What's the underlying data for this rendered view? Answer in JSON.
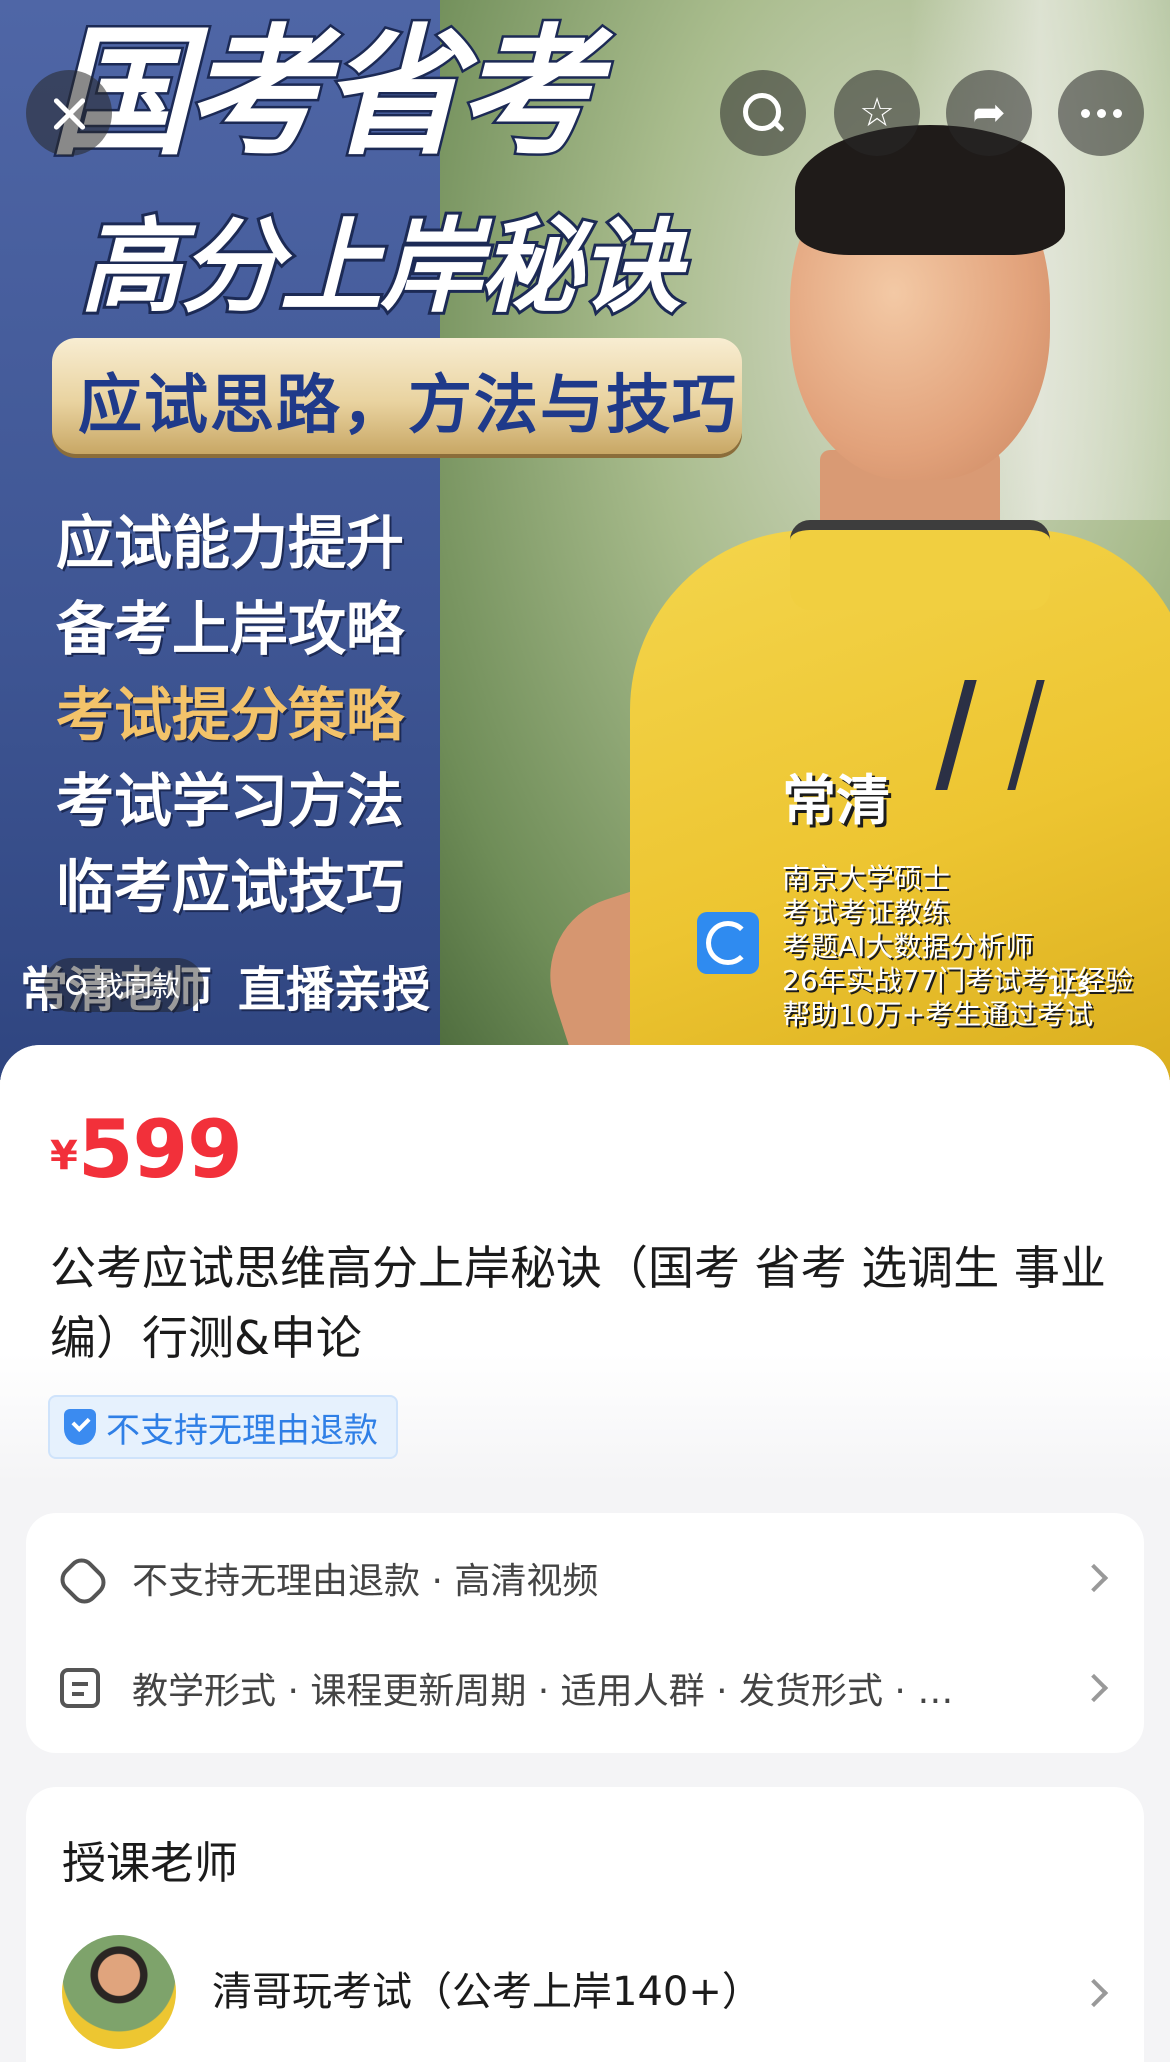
{
  "hero": {
    "headline_line1": "国考省考",
    "headline_line2": "高分上岸秘诀",
    "banner_text": "应试思路，方法与技巧",
    "bullet_lines": [
      "应试能力提升",
      "备考上岸攻略",
      "考试提分策略",
      "考试学习方法",
      "临考应试技巧"
    ],
    "bottom_left": "常清老师",
    "bottom_mid": "直播亲授",
    "teacher_name": "常清",
    "teacher_bio": [
      "南京大学硕士",
      "考试考证教练",
      "考题AI大数据分析师",
      "26年实战77门考试考证经验",
      "帮助10万+考生通过考试"
    ],
    "find_similar": "找同款",
    "page_indicator": "1/3"
  },
  "actions": {
    "close": "close-icon",
    "search": "search-icon",
    "favorite": "☆",
    "share": "➦",
    "more": "more-icon"
  },
  "product": {
    "currency": "¥",
    "price": "599",
    "title": "公考应试思维高分上岸秘诀（国考 省考 选调生 事业编）行测&申论",
    "refund_chip": "不支持无理由退款",
    "info_rows": [
      "不支持无理由退款 · 高清视频",
      "教学形式 · 课程更新周期 · 适用人群 · 发货形式 · …"
    ]
  },
  "teacher_section": {
    "title": "授课老师",
    "name": "清哥玩考试（公考上岸140+）"
  },
  "colors": {
    "price_red": "#f2303a",
    "chip_blue": "#2f7fe6",
    "shirt_yellow": "#edc531"
  }
}
